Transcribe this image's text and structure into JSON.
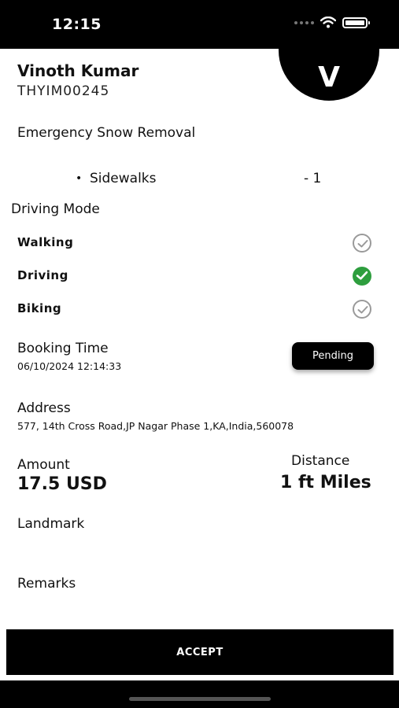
{
  "status_bar": {
    "time": "12:15"
  },
  "avatar": {
    "initial": "V"
  },
  "user": {
    "name": "Vinoth Kumar",
    "code": "THYIM00245"
  },
  "service": {
    "title": "Emergency Snow Removal",
    "items": [
      {
        "name": "Sidewalks",
        "quantity": "- 1"
      }
    ]
  },
  "driving_mode": {
    "title": "Driving Mode",
    "options": [
      {
        "label": "Walking",
        "selected": false
      },
      {
        "label": "Driving",
        "selected": true
      },
      {
        "label": "Biking",
        "selected": false
      }
    ]
  },
  "booking": {
    "label": "Booking Time",
    "value": "06/10/2024 12:14:33",
    "status": "Pending"
  },
  "address": {
    "label": "Address",
    "value": "577, 14th Cross Road,JP Nagar Phase 1,KA,India,560078"
  },
  "amount": {
    "label": "Amount",
    "value": "17.5 USD"
  },
  "distance": {
    "label": "Distance",
    "value": "1 ft Miles"
  },
  "landmark": {
    "label": "Landmark",
    "value": ""
  },
  "remarks": {
    "label": "Remarks",
    "value": ""
  },
  "actions": {
    "accept": "ACCEPT"
  },
  "colors": {
    "selected_check": "#2e9e3e",
    "unselected_check": "#9a9a9a",
    "button_bg": "#000000"
  }
}
